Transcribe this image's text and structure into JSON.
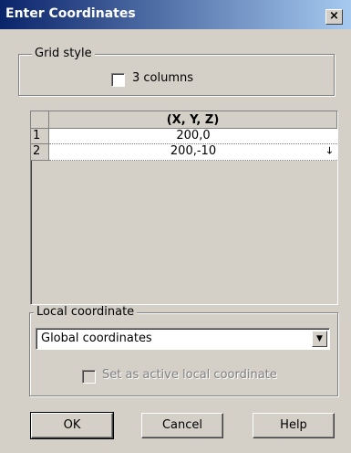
{
  "dialog": {
    "title": "Enter Coordinates",
    "close_glyph": "×"
  },
  "grid_style": {
    "legend": "Grid style",
    "checkbox_label": "3 columns",
    "checked": false
  },
  "grid": {
    "header": "(X, Y, Z)",
    "rows": [
      {
        "index": "1",
        "value": "200,0"
      },
      {
        "index": "2",
        "value": "200,-10"
      }
    ],
    "dropdown_glyph": "🡓"
  },
  "local_coordinate": {
    "legend": "Local coordinate",
    "selected": "Global coordinates",
    "active_label": "Set as active local coordinate",
    "active_checked": false,
    "active_enabled": false
  },
  "buttons": {
    "ok": "OK",
    "cancel": "Cancel",
    "help": "Help"
  }
}
